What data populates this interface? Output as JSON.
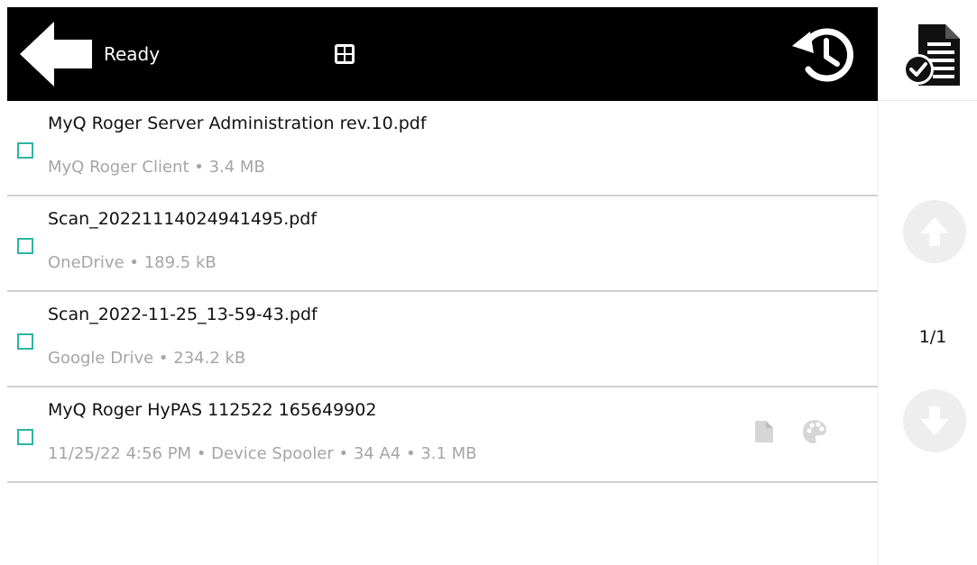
{
  "header": {
    "status": "Ready"
  },
  "files": [
    {
      "name": "MyQ Roger Server Administration rev.10.pdf",
      "meta": "MyQ Roger Client • 3.4 MB"
    },
    {
      "name": "Scan_20221114024941495.pdf",
      "meta": "OneDrive • 189.5 kB"
    },
    {
      "name": "Scan_2022-11-25_13-59-43.pdf",
      "meta": "Google Drive • 234.2 kB"
    },
    {
      "name": "MyQ Roger HyPAS 112522 165649902",
      "meta": "11/25/22 4:56 PM • Device Spooler • 34 A4 • 3.1 MB",
      "icons": [
        "document-icon",
        "palette-icon"
      ]
    }
  ],
  "pagination": {
    "indicator": "1/1"
  },
  "icons": {
    "back": "back-arrow-icon",
    "grid": "grid-view-icon",
    "history": "history-icon",
    "doc": "document-check-icon",
    "up": "arrow-up-icon",
    "down": "arrow-down-icon"
  },
  "colors": {
    "header_bg": "#000000",
    "checkbox": "#2bb5a0",
    "meta_text": "#a5a5a5",
    "nav_button": "#eeeeee"
  }
}
